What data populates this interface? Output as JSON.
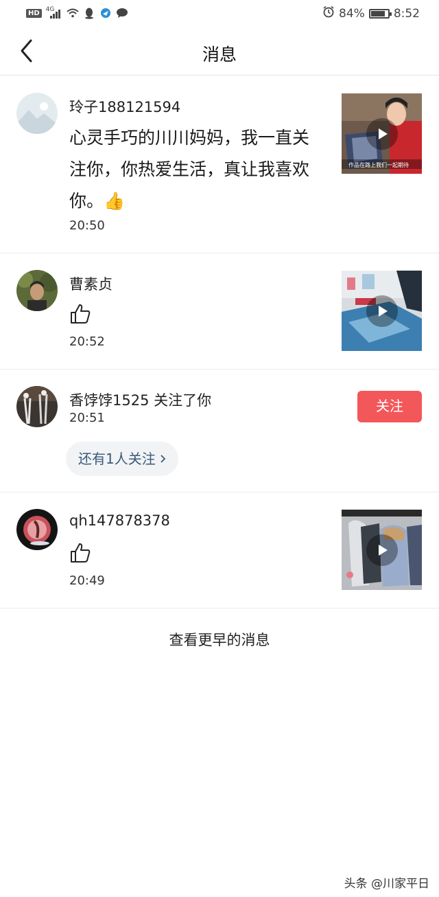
{
  "status_bar": {
    "hd": "HD",
    "network": "4G",
    "battery_percent": "84%",
    "battery_level": 0.84,
    "time": "8:52"
  },
  "header": {
    "title": "消息"
  },
  "messages": [
    {
      "name": "玲子188121594",
      "text": "心灵手巧的川川妈妈，我一直关注你，你热爱生活，真让我喜欢你。👍",
      "time": "20:50",
      "thumb_caption": "作品在路上我们一起期待"
    },
    {
      "name": "曹素贞",
      "time": "20:52"
    },
    {
      "name": "香饽饽1525 关注了你",
      "time": "20:51",
      "follow_label": "关注",
      "more_label": "还有1人关注"
    },
    {
      "name": "qh147878378",
      "time": "20:49"
    }
  ],
  "load_earlier": "查看更早的消息",
  "watermark": "头条 @川家平日",
  "colors": {
    "accent": "#f2575a",
    "link": "#3a5a7a",
    "divider": "#ececec"
  }
}
